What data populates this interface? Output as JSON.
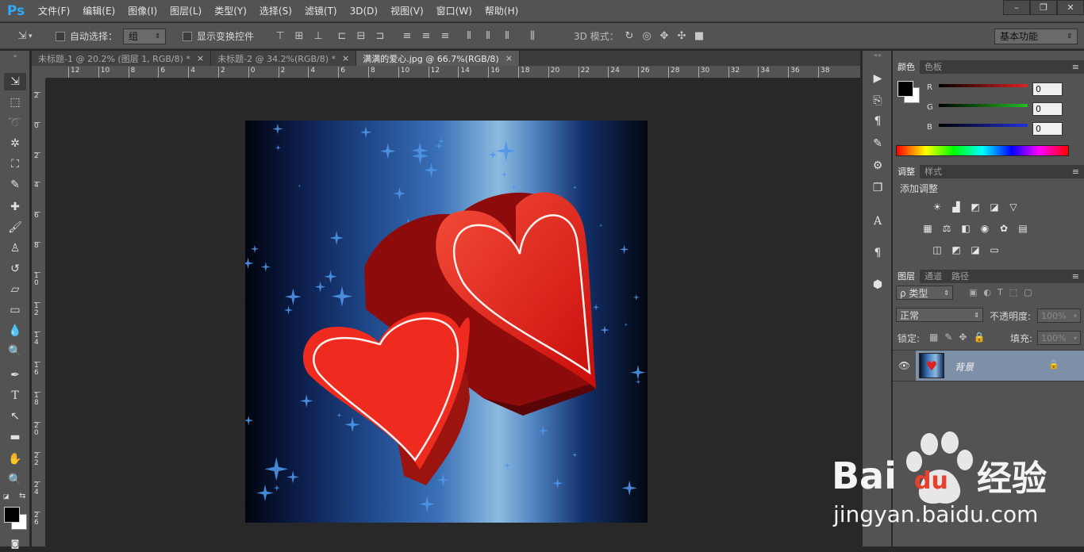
{
  "app": {
    "logo": "Ps"
  },
  "menu": [
    "文件(F)",
    "编辑(E)",
    "图像(I)",
    "图层(L)",
    "类型(Y)",
    "选择(S)",
    "滤镜(T)",
    "3D(D)",
    "视图(V)",
    "窗口(W)",
    "帮助(H)"
  ],
  "window_controls": {
    "minimize": "–",
    "restore": "❐",
    "close": "✕"
  },
  "options": {
    "auto_select_label": "自动选择：",
    "auto_select_value": "组",
    "show_transform_label": "显示变换控件",
    "mode_3d_label": "3D 模式：",
    "workspace": "基本功能"
  },
  "tabs": [
    {
      "label": "未标题-1 @ 20.2% (图层 1, RGB/8) *",
      "close": "×"
    },
    {
      "label": "未标题-2 @ 34.2%(RGB/8) *",
      "close": "×"
    },
    {
      "label": "满满的爱心.jpg @ 66.7%(RGB/8)",
      "close": "×"
    }
  ],
  "ruler_h": [
    "12",
    "10",
    "8",
    "6",
    "4",
    "2",
    "0",
    "2",
    "4",
    "6",
    "8",
    "10",
    "12",
    "14",
    "16",
    "18",
    "20",
    "22",
    "24",
    "26",
    "28",
    "30",
    "32",
    "34",
    "36",
    "38"
  ],
  "ruler_v": [
    "2",
    "0",
    "2",
    "4",
    "6",
    "8",
    "1 0",
    "1 2",
    "1 4",
    "1 6",
    "1 8",
    "2 0",
    "2 2",
    "2 4",
    "2 6"
  ],
  "color_panel": {
    "tabs": [
      "颜色",
      "色板"
    ],
    "channels": [
      {
        "label": "R",
        "value": "0",
        "color": "#e02020"
      },
      {
        "label": "G",
        "value": "0",
        "color": "#20c020"
      },
      {
        "label": "B",
        "value": "0",
        "color": "#2030e0"
      }
    ]
  },
  "adjust_panel": {
    "tabs": [
      "调整",
      "样式"
    ],
    "title": "添加调整",
    "icons": [
      "brightness-icon",
      "levels-icon",
      "curves-icon",
      "exposure-icon",
      "vibrance-icon",
      "hue-saturation-icon",
      "color-balance-icon",
      "black-white-icon",
      "photo-filter-icon",
      "channel-mixer-icon",
      "color-lookup-icon",
      "invert-icon",
      "posterize-icon",
      "threshold-icon",
      "gradient-map-icon",
      "selective-color-icon"
    ]
  },
  "layers_panel": {
    "tabs": [
      "图层",
      "通道",
      "路径"
    ],
    "filter_label": "ρ 类型",
    "blend_mode": "正常",
    "opacity_label": "不透明度:",
    "opacity_value": "100%",
    "lock_label": "锁定:",
    "fill_label": "填充:",
    "fill_value": "100%",
    "layers": [
      {
        "name": "背景",
        "visible": true,
        "locked": true
      }
    ]
  },
  "watermark": {
    "brand": "Bai",
    "brand2": "du",
    "product": "经验",
    "url": "jingyan.baidu.com"
  },
  "colors": {
    "accent": "#31a8ff",
    "heart_red": "#e8231e"
  }
}
